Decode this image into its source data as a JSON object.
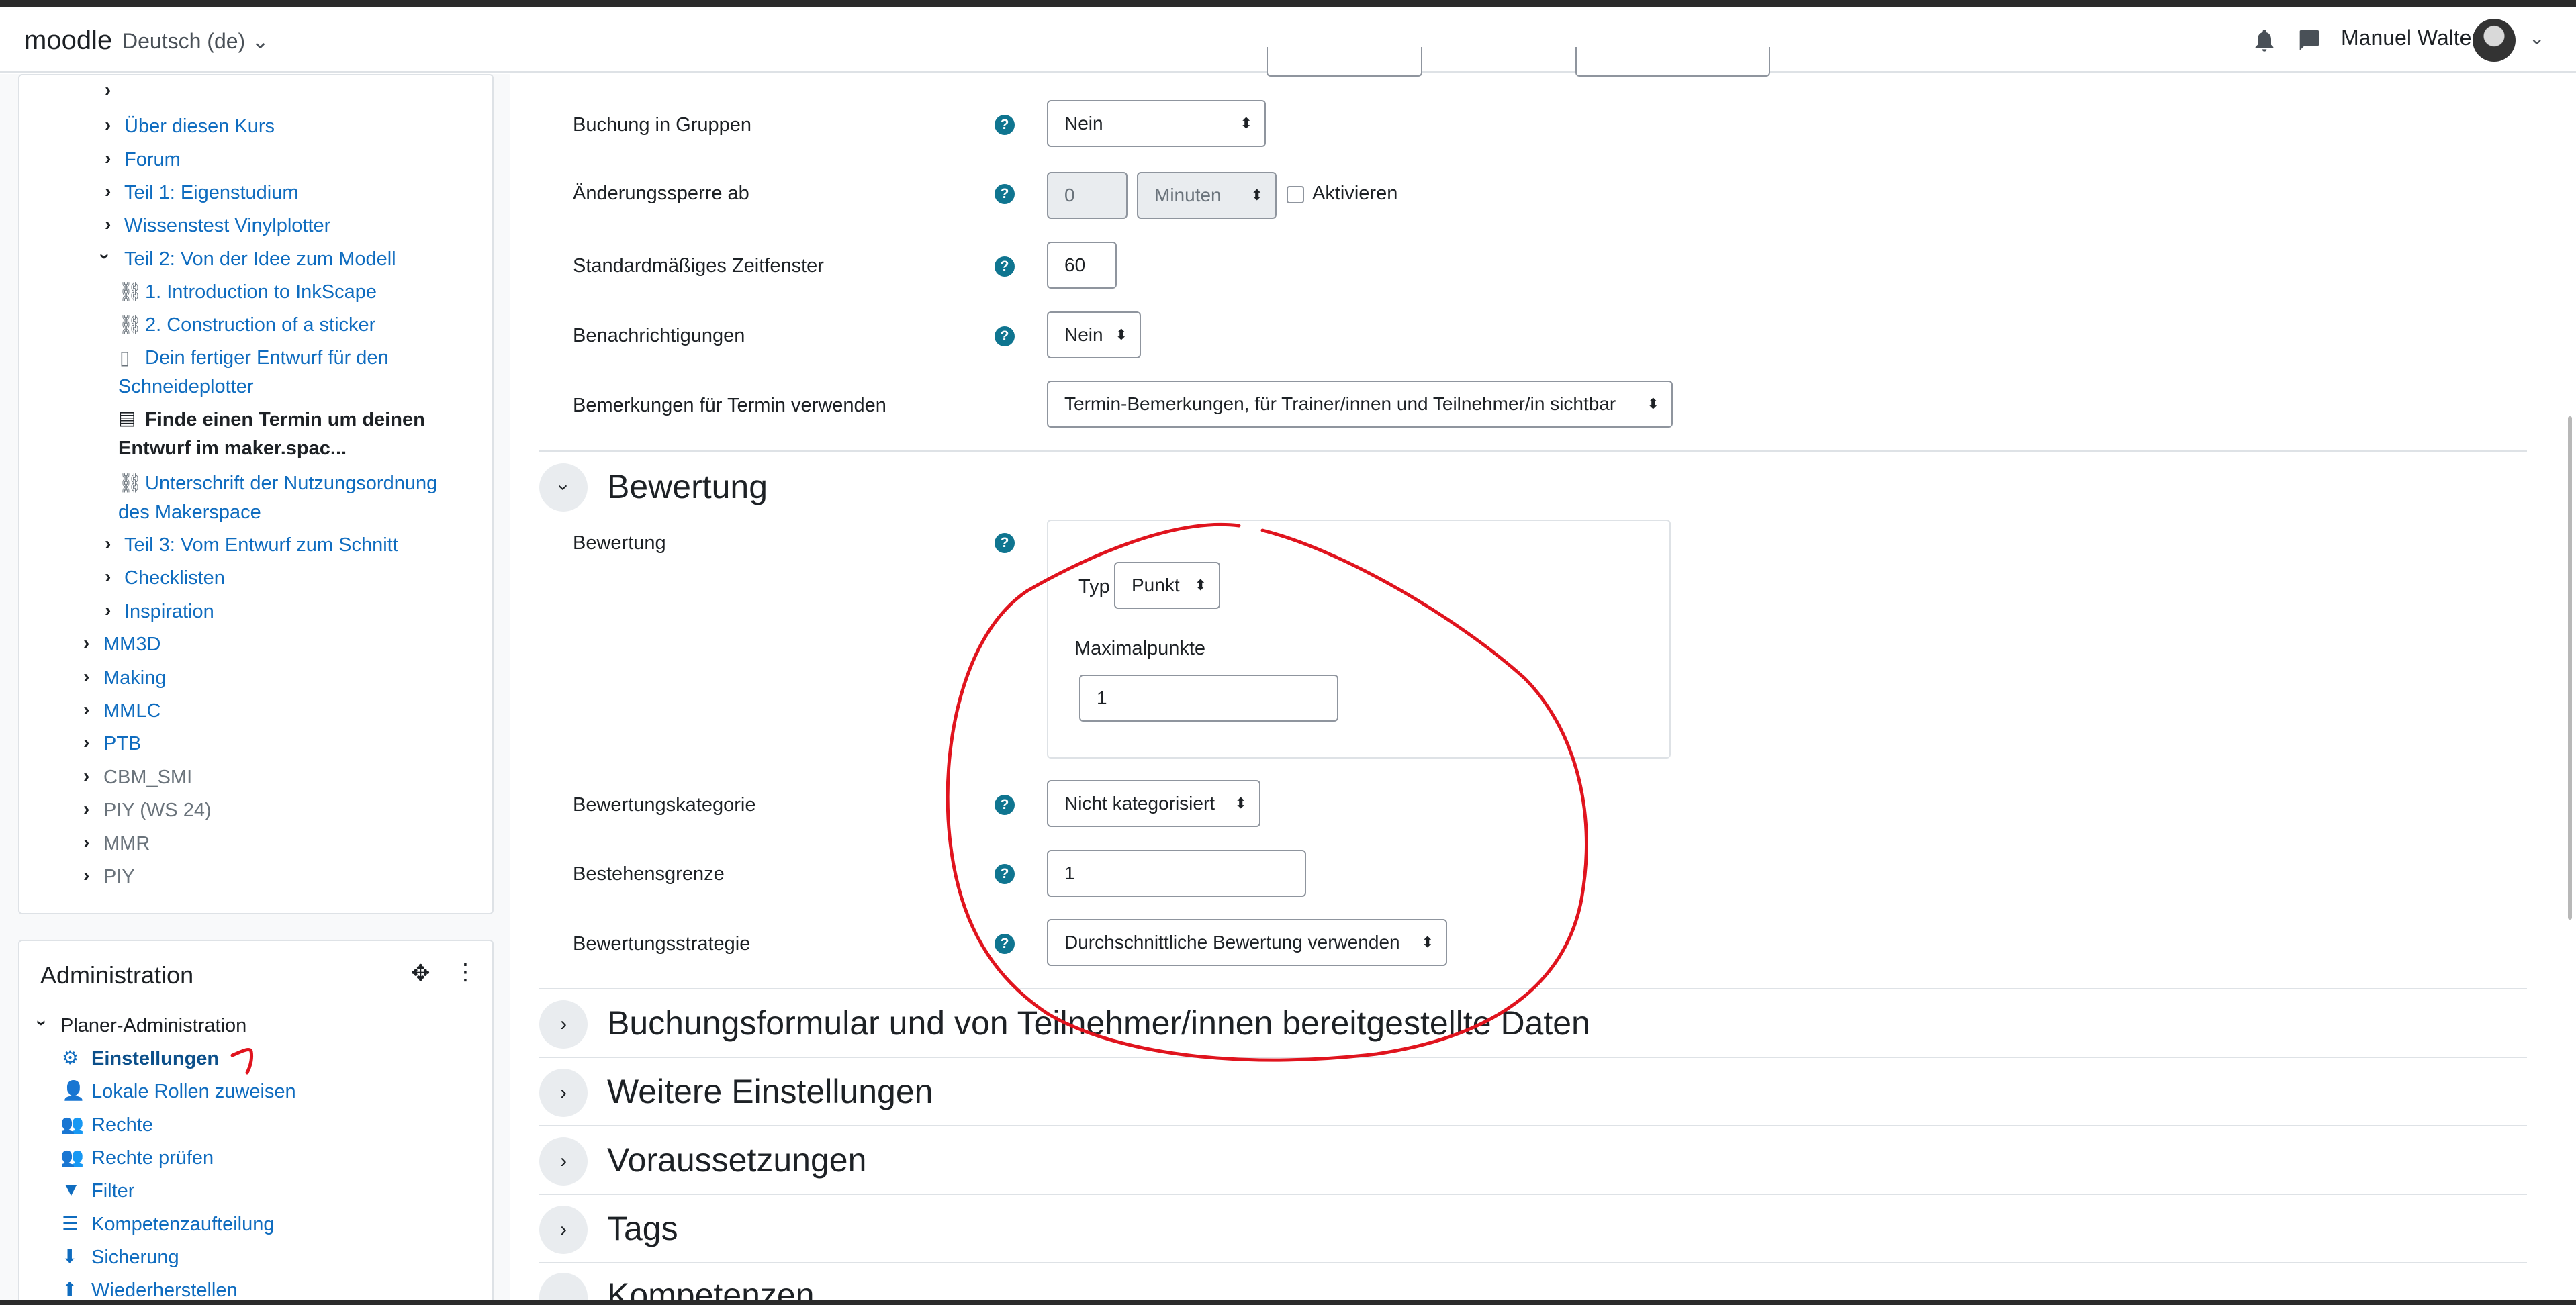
{
  "navbar": {
    "brand": "moodle",
    "language": "Deutsch (de)",
    "user_name": "Manuel Walter",
    "icons": [
      "bell-icon",
      "chat-icon",
      "chevron-down-icon"
    ]
  },
  "course_nav": {
    "items": [
      {
        "label": "Über diesen Kurs"
      },
      {
        "label": "Forum"
      },
      {
        "label": "Teil 1: Eigenstudium"
      },
      {
        "label": "Wissenstest Vinylplotter"
      },
      {
        "label": "Teil 2: Von der Idee zum Modell"
      },
      {
        "label": "1. Introduction to InkScape"
      },
      {
        "label": "2. Construction of a sticker"
      },
      {
        "label_line1": "Dein fertiger Entwurf für den",
        "label_line2": "Schneideplotter"
      },
      {
        "label_line1": "Finde einen Termin um deinen",
        "label_line2": "Entwurf im maker.spac..."
      },
      {
        "label_line1": "Unterschrift der Nutzungsordnung",
        "label_line2": "des Makerspace"
      },
      {
        "label": "Teil 3: Vom Entwurf zum Schnitt"
      },
      {
        "label": "Checklisten"
      },
      {
        "label": "Inspiration"
      },
      {
        "label": "MM3D"
      },
      {
        "label": "Making"
      },
      {
        "label": "MMLC"
      },
      {
        "label": "PTB"
      },
      {
        "label": "CBM_SMI"
      },
      {
        "label": "PIY (WS 24)"
      },
      {
        "label": "MMR"
      },
      {
        "label": "PIY"
      }
    ]
  },
  "admin": {
    "title": "Administration",
    "root": "Planer-Administration",
    "items": [
      {
        "label": "Einstellungen",
        "icon": "gear-icon"
      },
      {
        "label": "Lokale Rollen zuweisen",
        "icon": "user-icon"
      },
      {
        "label": "Rechte",
        "icon": "user-lock-icon"
      },
      {
        "label": "Rechte prüfen",
        "icon": "user-check-icon"
      },
      {
        "label": "Filter",
        "icon": "filter-icon"
      },
      {
        "label": "Kompetenzaufteilung",
        "icon": "list-icon"
      },
      {
        "label": "Sicherung",
        "icon": "download-icon"
      },
      {
        "label": "Wiederherstellen",
        "icon": "restore-icon"
      }
    ]
  },
  "form": {
    "booking_groups": {
      "label": "Buchung in Gruppen",
      "value": "Nein"
    },
    "lock": {
      "label": "Änderungssperre ab",
      "value": "0",
      "unit": "Minuten",
      "checkbox_label": "Aktivieren"
    },
    "timeslot": {
      "label": "Standardmäßiges Zeitfenster",
      "value": "60"
    },
    "notifications": {
      "label": "Benachrichtigungen",
      "value": "Nein"
    },
    "remarks": {
      "label": "Bemerkungen für Termin verwenden",
      "value": "Termin-Bemerkungen, für Trainer/innen und Teilnehmer/in sichtbar"
    },
    "grading_section": "Bewertung",
    "grade": {
      "label": "Bewertung",
      "type_label": "Typ",
      "type_value": "Punkt",
      "max_label": "Maximalpunkte",
      "max_value": "1"
    },
    "grade_category": {
      "label": "Bewertungskategorie",
      "value": "Nicht kategorisiert"
    },
    "pass_grade": {
      "label": "Bestehensgrenze",
      "value": "1"
    },
    "grade_strategy": {
      "label": "Bewertungsstrategie",
      "value": "Durchschnittliche Bewertung verwenden"
    },
    "sections": [
      "Buchungsformular und von Teilnehmer/innen bereitgestellte Daten",
      "Weitere Einstellungen",
      "Voraussetzungen",
      "Tags",
      "Kompetenzen"
    ]
  },
  "annotation": {
    "mark_label": "1",
    "color": "#e0141e"
  }
}
